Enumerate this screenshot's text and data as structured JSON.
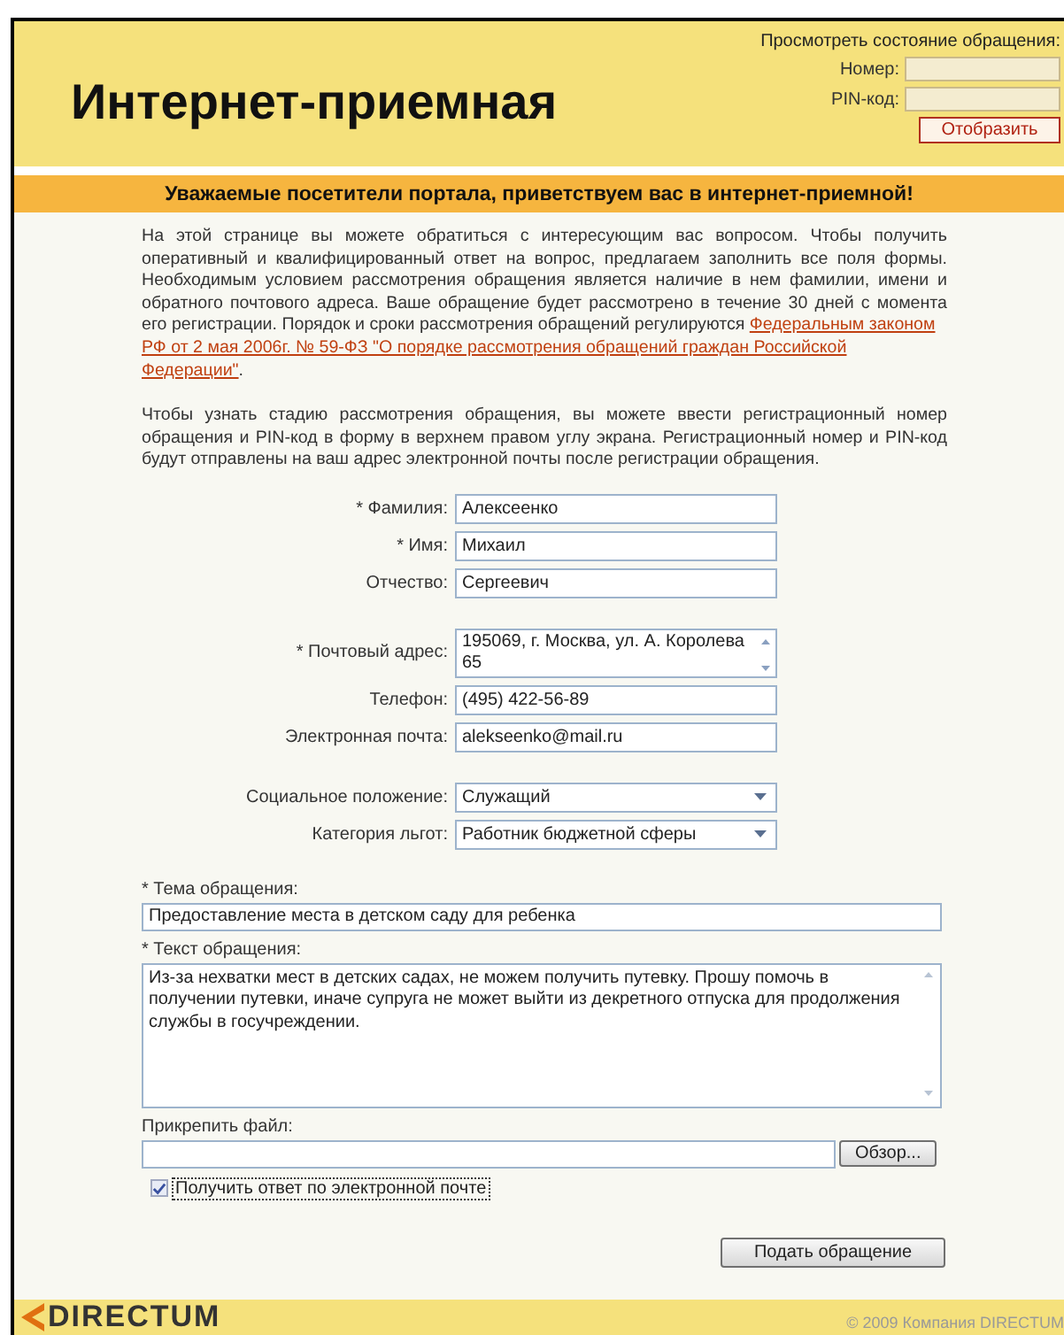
{
  "header": {
    "title": "Интернет-приемная",
    "status_check": {
      "heading": "Просмотреть состояние обращения:",
      "fields": [
        {
          "label": "Номер:"
        },
        {
          "label": "PIN-код:"
        }
      ],
      "button": "Отобразить"
    }
  },
  "banner": "Уважаемые посетители портала, приветствуем вас в интернет-приемной!",
  "intro": {
    "text_before": "На этой странице вы можете обратиться с интересующим вас вопросом. Чтобы получить оперативный и квалифицированный ответ на вопрос, предлагаем заполнить все поля формы. Необходимым условием рассмотрения обращения является наличие в нем фамилии, имени и обратного почтового адреса. Ваше обращение будет рассмотрено в течение 30 дней с момента его регистрации. Порядок и сроки рассмотрения обращений регулируются ",
    "link_lines": [
      "Федеральным законом",
      "РФ от 2 мая 2006г. № 59-ФЗ \"О порядке рассмотрения обращений граждан Российской",
      "Федерации\""
    ],
    "text_after": "."
  },
  "intro_2": "Чтобы узнать стадию рассмотрения обращения, вы можете ввести регистрационный номер обращения и PIN-код в форму в верхнем правом углу экрана. Регистрационный номер и PIN-код будут отправлены на ваш адрес электронной почты после регистрации обращения.",
  "field_groups": [
    [
      {
        "kind": "text",
        "label": "* Фамилия:",
        "value": "Алексеенко"
      },
      {
        "kind": "text",
        "label": "* Имя:",
        "value": "Михаил"
      },
      {
        "kind": "text",
        "label": "Отчество:",
        "value": "Сергеевич"
      }
    ],
    [
      {
        "kind": "textarea",
        "label": "* Почтовый адрес:",
        "value": "195069, г. Москва, ул. А. Королева 65"
      },
      {
        "kind": "text",
        "label": "Телефон:",
        "value": "(495) 422-56-89"
      },
      {
        "kind": "text",
        "label": "Электронная почта:",
        "value": "alekseenko@mail.ru"
      }
    ],
    [
      {
        "kind": "select",
        "label": "Социальное положение:",
        "value": "Служащий"
      },
      {
        "kind": "select",
        "label": "Категория льгот:",
        "value": "Работник бюджетной сферы"
      }
    ]
  ],
  "subject": {
    "label": "* Тема обращения:",
    "value": "Предоставление места в детском саду для ребенка"
  },
  "message": {
    "label": "* Текст обращения:",
    "value": "Из-за нехватки мест в детских садах, не можем получить путевку. Прошу помочь в получении путевки, иначе супруга не может выйти из декретного отпуска для продолжения службы в госучреждении."
  },
  "attachment": {
    "label": "Прикрепить файл:",
    "button": "Обзор..."
  },
  "email_reply": {
    "label": "Получить ответ по электронной почте",
    "checked": true
  },
  "submit_button": "Подать обращение",
  "footer": {
    "logo": "DIRECTUM",
    "copyright": "© 2009 Компания DIRECTUM"
  }
}
